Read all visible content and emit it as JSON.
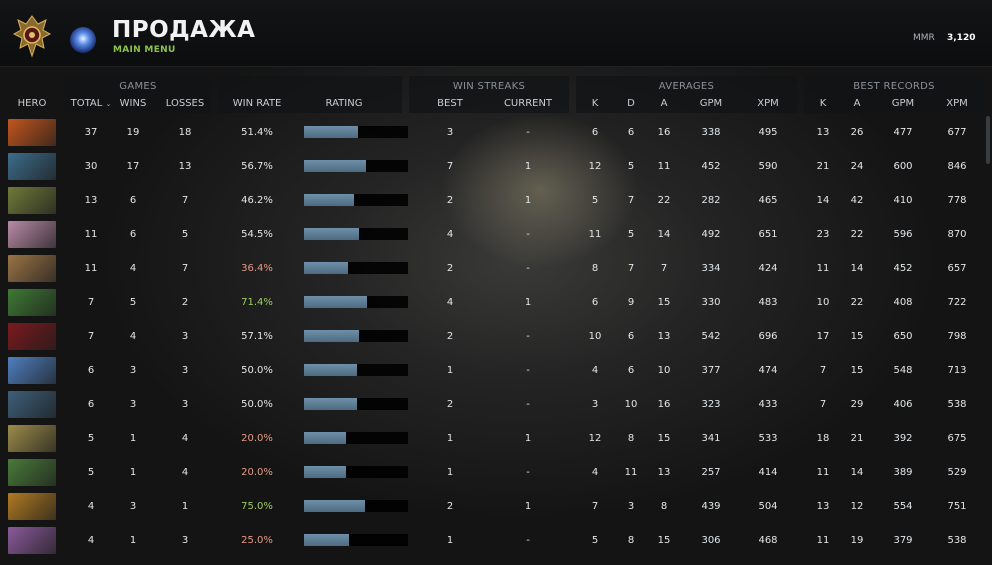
{
  "header": {
    "title": "ПРОДАЖА",
    "subtitle": "MAIN MENU",
    "mmr_label": "MMR",
    "mmr_value": "3,120"
  },
  "groups": {
    "games": "GAMES",
    "win_streaks": "WIN STREAKS",
    "averages": "AVERAGES",
    "best_records": "BEST RECORDS"
  },
  "columns": {
    "hero": "HERO",
    "total": "TOTAL",
    "wins": "WINS",
    "losses": "LOSSES",
    "win_rate": "WIN RATE",
    "rating": "RATING",
    "best": "BEST",
    "current": "CURRENT",
    "k": "K",
    "d": "D",
    "a": "A",
    "gpm": "GPM",
    "xpm": "XPM",
    "rec_k": "K",
    "rec_a": "A",
    "rec_gpm": "GPM",
    "rec_xpm": "XPM"
  },
  "sort_icon": "chevron-down-icon",
  "colors": {
    "win_rate_high": "#9ccc65",
    "win_rate_low": "#e49a86",
    "rating_bar": "#5d7d96",
    "subtitle": "#8bc34a"
  },
  "rows": [
    {
      "total": "37",
      "wins": "19",
      "losses": "18",
      "win_rate": "51.4%",
      "rating": 0.52,
      "best": "3",
      "current": "-",
      "k": "6",
      "d": "6",
      "a": "16",
      "gpm": "338",
      "xpm": "495",
      "rk": "13",
      "ra": "26",
      "rgpm": "477",
      "rxpm": "677",
      "hero_color": "#c2561e"
    },
    {
      "total": "30",
      "wins": "17",
      "losses": "13",
      "win_rate": "56.7%",
      "rating": 0.6,
      "best": "7",
      "current": "1",
      "k": "12",
      "d": "5",
      "a": "11",
      "gpm": "452",
      "xpm": "590",
      "rk": "21",
      "ra": "24",
      "rgpm": "600",
      "rxpm": "846",
      "hero_color": "#3d6c8a"
    },
    {
      "total": "13",
      "wins": "6",
      "losses": "7",
      "win_rate": "46.2%",
      "rating": 0.48,
      "best": "2",
      "current": "1",
      "k": "5",
      "d": "7",
      "a": "22",
      "gpm": "282",
      "xpm": "465",
      "rk": "14",
      "ra": "42",
      "rgpm": "410",
      "rxpm": "778",
      "hero_color": "#6f7a3a"
    },
    {
      "total": "11",
      "wins": "6",
      "losses": "5",
      "win_rate": "54.5%",
      "rating": 0.53,
      "best": "4",
      "current": "-",
      "k": "11",
      "d": "5",
      "a": "14",
      "gpm": "492",
      "xpm": "651",
      "rk": "23",
      "ra": "22",
      "rgpm": "596",
      "rxpm": "870",
      "hero_color": "#b88aa6"
    },
    {
      "total": "11",
      "wins": "4",
      "losses": "7",
      "win_rate": "36.4%",
      "rating": 0.42,
      "best": "2",
      "current": "-",
      "k": "8",
      "d": "7",
      "a": "7",
      "gpm": "334",
      "xpm": "424",
      "rk": "11",
      "ra": "14",
      "rgpm": "452",
      "rxpm": "657",
      "hero_color": "#9a7446"
    },
    {
      "total": "7",
      "wins": "5",
      "losses": "2",
      "win_rate": "71.4%",
      "rating": 0.61,
      "best": "4",
      "current": "1",
      "k": "6",
      "d": "9",
      "a": "15",
      "gpm": "330",
      "xpm": "483",
      "rk": "10",
      "ra": "22",
      "rgpm": "408",
      "rxpm": "722",
      "hero_color": "#3e7a34"
    },
    {
      "total": "7",
      "wins": "4",
      "losses": "3",
      "win_rate": "57.1%",
      "rating": 0.53,
      "best": "2",
      "current": "-",
      "k": "10",
      "d": "6",
      "a": "13",
      "gpm": "542",
      "xpm": "696",
      "rk": "17",
      "ra": "15",
      "rgpm": "650",
      "rxpm": "798",
      "hero_color": "#7a1a1e"
    },
    {
      "total": "6",
      "wins": "3",
      "losses": "3",
      "win_rate": "50.0%",
      "rating": 0.51,
      "best": "1",
      "current": "-",
      "k": "4",
      "d": "6",
      "a": "10",
      "gpm": "377",
      "xpm": "474",
      "rk": "7",
      "ra": "15",
      "rgpm": "548",
      "rxpm": "713",
      "hero_color": "#4f7fbf"
    },
    {
      "total": "6",
      "wins": "3",
      "losses": "3",
      "win_rate": "50.0%",
      "rating": 0.51,
      "best": "2",
      "current": "-",
      "k": "3",
      "d": "10",
      "a": "16",
      "gpm": "323",
      "xpm": "433",
      "rk": "7",
      "ra": "29",
      "rgpm": "406",
      "rxpm": "538",
      "hero_color": "#3d5f7a"
    },
    {
      "total": "5",
      "wins": "1",
      "losses": "4",
      "win_rate": "20.0%",
      "rating": 0.4,
      "best": "1",
      "current": "1",
      "k": "12",
      "d": "8",
      "a": "15",
      "gpm": "341",
      "xpm": "533",
      "rk": "18",
      "ra": "21",
      "rgpm": "392",
      "rxpm": "675",
      "hero_color": "#9b8b4a"
    },
    {
      "total": "5",
      "wins": "1",
      "losses": "4",
      "win_rate": "20.0%",
      "rating": 0.4,
      "best": "1",
      "current": "-",
      "k": "4",
      "d": "11",
      "a": "13",
      "gpm": "257",
      "xpm": "414",
      "rk": "11",
      "ra": "14",
      "rgpm": "389",
      "rxpm": "529",
      "hero_color": "#4a7a3a"
    },
    {
      "total": "4",
      "wins": "3",
      "losses": "1",
      "win_rate": "75.0%",
      "rating": 0.59,
      "best": "2",
      "current": "1",
      "k": "7",
      "d": "3",
      "a": "8",
      "gpm": "439",
      "xpm": "504",
      "rk": "13",
      "ra": "12",
      "rgpm": "554",
      "rxpm": "751",
      "hero_color": "#b07a22"
    },
    {
      "total": "4",
      "wins": "1",
      "losses": "3",
      "win_rate": "25.0%",
      "rating": 0.43,
      "best": "1",
      "current": "-",
      "k": "5",
      "d": "8",
      "a": "15",
      "gpm": "306",
      "xpm": "468",
      "rk": "11",
      "ra": "19",
      "rgpm": "379",
      "rxpm": "538",
      "hero_color": "#8a5a9a"
    }
  ]
}
